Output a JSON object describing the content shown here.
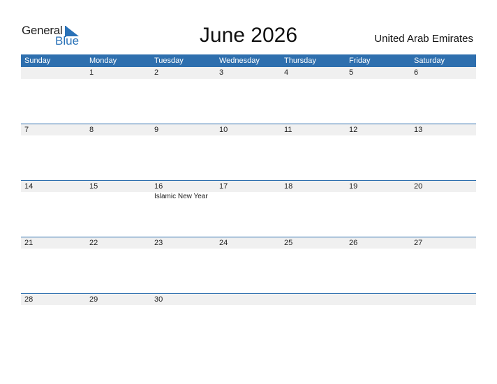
{
  "logo": {
    "general": "General",
    "blue": "Blue"
  },
  "title": "June 2026",
  "country": "United Arab Emirates",
  "weekdays": [
    "Sunday",
    "Monday",
    "Tuesday",
    "Wednesday",
    "Thursday",
    "Friday",
    "Saturday"
  ],
  "weeks": [
    {
      "days": [
        "",
        "1",
        "2",
        "3",
        "4",
        "5",
        "6"
      ],
      "events": [
        "",
        "",
        "",
        "",
        "",
        "",
        ""
      ]
    },
    {
      "days": [
        "7",
        "8",
        "9",
        "10",
        "11",
        "12",
        "13"
      ],
      "events": [
        "",
        "",
        "",
        "",
        "",
        "",
        ""
      ]
    },
    {
      "days": [
        "14",
        "15",
        "16",
        "17",
        "18",
        "19",
        "20"
      ],
      "events": [
        "",
        "",
        "Islamic New Year",
        "",
        "",
        "",
        ""
      ]
    },
    {
      "days": [
        "21",
        "22",
        "23",
        "24",
        "25",
        "26",
        "27"
      ],
      "events": [
        "",
        "",
        "",
        "",
        "",
        "",
        ""
      ]
    },
    {
      "days": [
        "28",
        "29",
        "30",
        "",
        "",
        "",
        ""
      ],
      "events": [
        "",
        "",
        "",
        "",
        "",
        "",
        ""
      ]
    }
  ],
  "colors": {
    "accent": "#2e6fae",
    "logo_blue": "#2a72b8",
    "row_bg": "#f0f0f0"
  }
}
